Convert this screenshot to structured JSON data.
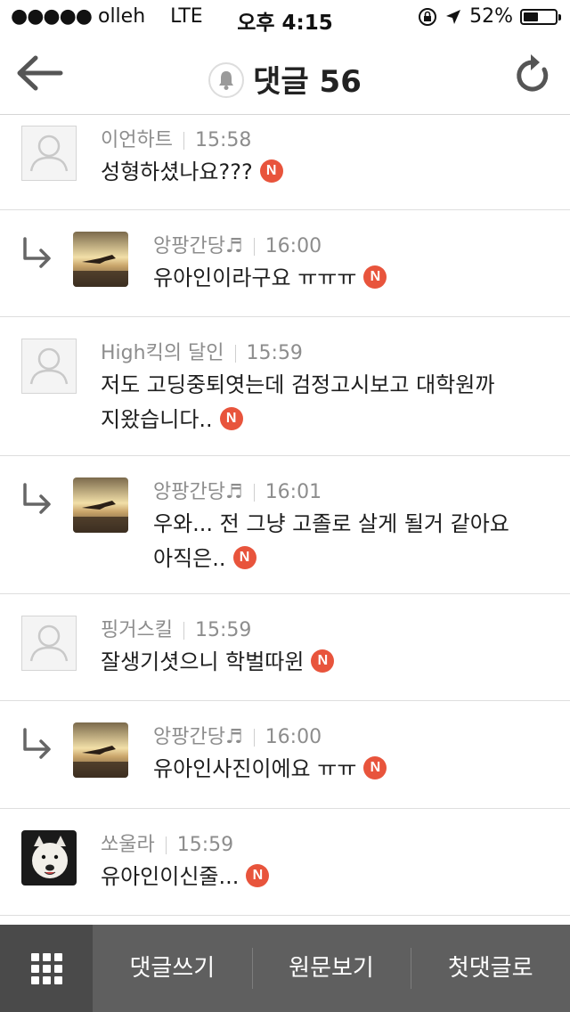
{
  "status_bar": {
    "carrier": "olleh",
    "network": "LTE",
    "time": "오후 4:15",
    "battery_percent": "52%",
    "battery_level": 0.52
  },
  "nav": {
    "title": "댓글 56",
    "icons": {
      "back": "arrow-left-icon",
      "bell": "bell-icon",
      "refresh": "refresh-icon"
    }
  },
  "comments": [
    {
      "author": "이언하트",
      "time": "15:58",
      "text": "성형하셨나요???",
      "is_reply": false,
      "avatar": "default-avatar-icon",
      "new": "N"
    },
    {
      "author": "앙팡간당♬",
      "time": "16:00",
      "text": "유아인이라구요 ㅠㅠㅠ",
      "is_reply": true,
      "avatar": "sunset-photo",
      "new": "N"
    },
    {
      "author": "High킥의 달인",
      "time": "15:59",
      "text": "저도 고딩중퇴엿는데 검정고시보고 대학원까",
      "text2": "지왔습니다..",
      "is_reply": false,
      "avatar": "default-avatar-icon",
      "new": "N"
    },
    {
      "author": "앙팡간당♬",
      "time": "16:01",
      "text": "우와... 전 그냥 고졸로 살게 될거 같아요",
      "text2": "아직은..",
      "is_reply": true,
      "avatar": "sunset-photo",
      "new": "N"
    },
    {
      "author": "핑거스킬",
      "time": "15:59",
      "text": "잘생기셧으니 학벌따윈",
      "is_reply": false,
      "avatar": "default-avatar-icon",
      "new": "N"
    },
    {
      "author": "앙팡간당♬",
      "time": "16:00",
      "text": "유아인사진이에요 ㅠㅠ",
      "is_reply": true,
      "avatar": "sunset-photo",
      "new": "N"
    },
    {
      "author": "쏘울라",
      "time": "15:59",
      "text": "유아인이신줄...",
      "is_reply": false,
      "avatar": "dog-photo",
      "new": "N"
    }
  ],
  "toolbar": {
    "menu_icon": "grid-menu-icon",
    "write": "댓글쓰기",
    "original": "원문보기",
    "first": "첫댓글로"
  },
  "colors": {
    "new_badge": "#e8543c",
    "toolbar_bg": "#5f5f5f",
    "toolbar_dark": "#4a4a4a"
  }
}
